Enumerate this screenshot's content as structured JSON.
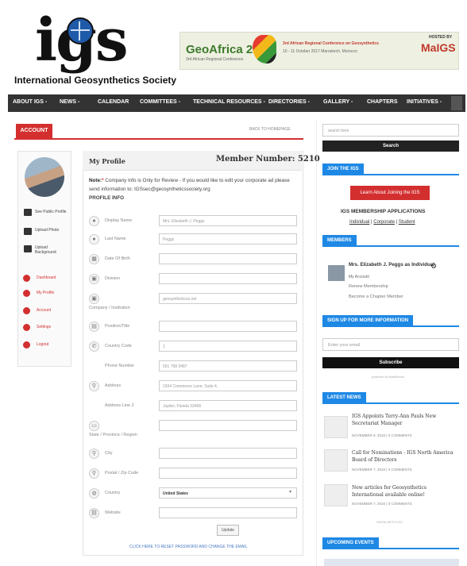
{
  "site": {
    "logo_text": "igs",
    "society_name": "International Geosynthetics Society"
  },
  "banner": {
    "title": "GeoAfrica 2017",
    "subtitle": "3rd African Regional Conference on Geosynthetics",
    "hosted_by": "HOSTED BY",
    "host_logo": "MaIGS",
    "dates": "10 - 11 October 2017 Marrakech, Morocco",
    "title_sub": "3rd African Regional Conference"
  },
  "nav": {
    "items": [
      "ABOUT IGS",
      "NEWS",
      "CALENDAR",
      "COMMITTEES",
      "TECHNICAL RESOURCES",
      "DIRECTORIES",
      "GALLERY",
      "CHAPTERS",
      "INITIATIVES"
    ],
    "dropdown_marks": [
      "-",
      "-",
      "",
      "-",
      "-",
      "-",
      "-",
      "",
      "-"
    ]
  },
  "account": {
    "tab_label": "ACCOUNT",
    "back_link": "BACK TO HOMEPAGE"
  },
  "left_panel": {
    "see_public": "See Public Profile",
    "upload_photo": "Upload Photo",
    "upload_background": "Upload Background",
    "menu": [
      "Dashboard",
      "My Profile",
      "Account",
      "Settings",
      "Logout"
    ]
  },
  "profile": {
    "title": "My Profile",
    "member_number": "Member Number: 5210",
    "note_lead": "Note:",
    "note_star": "*",
    "note_text": " Company Info is Only for Review - If you would like to edit your corporate ad please send information to: IGSsec@geosyntheticssociety.org",
    "section_label": "PROFILE INFO",
    "fields": [
      {
        "label": "Display Name",
        "value": "Mrs. Elizabeth J. Peggs",
        "icon": "user"
      },
      {
        "label": "Last Name",
        "value": "Peggs",
        "icon": "user"
      },
      {
        "label": "Date Of Birth",
        "value": "",
        "icon": "calendar"
      },
      {
        "label": "Division",
        "value": "",
        "icon": "building"
      },
      {
        "label": "Company / Institution",
        "value": "geosyntheticsci.net",
        "icon": "building"
      },
      {
        "label": "Position/Title",
        "value": "",
        "icon": "briefcase"
      },
      {
        "label": "Country Code",
        "value": "1",
        "icon": "phone"
      },
      {
        "label": "Phone Number",
        "value": "561 768 9487",
        "icon": ""
      },
      {
        "label": "Address",
        "value": "1934 Commerce Lane, Suite 4,",
        "icon": "map-pin"
      },
      {
        "label": "Address Line 2",
        "value": "Jupiter, Florida 33458",
        "icon": ""
      },
      {
        "label": "State / Province / Region",
        "value": "",
        "icon": "map"
      },
      {
        "label": "City",
        "value": "",
        "icon": "map-pin"
      },
      {
        "label": "Postal / Zip Code",
        "value": "",
        "icon": "map-pin"
      },
      {
        "label": "Country",
        "value": "United States",
        "icon": "globe"
      },
      {
        "label": "Website",
        "value": "",
        "icon": "link"
      }
    ],
    "update_label": "Update",
    "reset_link": "CLICK HERE TO RESET PASSWORD AND CHANGE THE EMAIL"
  },
  "sidebar": {
    "search_placeholder": "search here",
    "search_button": "Search",
    "join_title": "JOIN THE IGS",
    "learn_button": "Learn About Joining the IGS",
    "membership_heading": "IGS MEMBERSHIP APPLICATIONS",
    "membership_links": [
      "Individual",
      "Corporate",
      "Student"
    ],
    "members_title": "MEMBERS",
    "member_name": "Mrs. Elizabeth J. Peggs as Individual",
    "my_account": "My Account",
    "renew": "Renew Membership",
    "chapter": "Become a Chapter Member",
    "signup_title": "SIGN UP FOR MORE INFORMATION",
    "email_placeholder": "Enter your email",
    "subscribe": "Subscribe",
    "powered": "powered by MailMunch",
    "news_title": "LATEST NEWS",
    "news": [
      {
        "title": "IGS Appoints Terry-Ann Pauls New Secretariat Manager",
        "meta": "NOVEMBER 9, 2016 | 0 COMMENTS"
      },
      {
        "title": "Call for Nominations - IGS North America Board of Directors",
        "meta": "NOVEMBER 7, 2016 | 0 COMMENTS"
      },
      {
        "title": "New articles for Geosynthetics International available online!",
        "meta": "NOVEMBER 7, 2016 | 0 COMMENTS"
      }
    ],
    "show_all": "SHOW ARTICLES",
    "events_title": "UPCOMING EVENTS"
  }
}
